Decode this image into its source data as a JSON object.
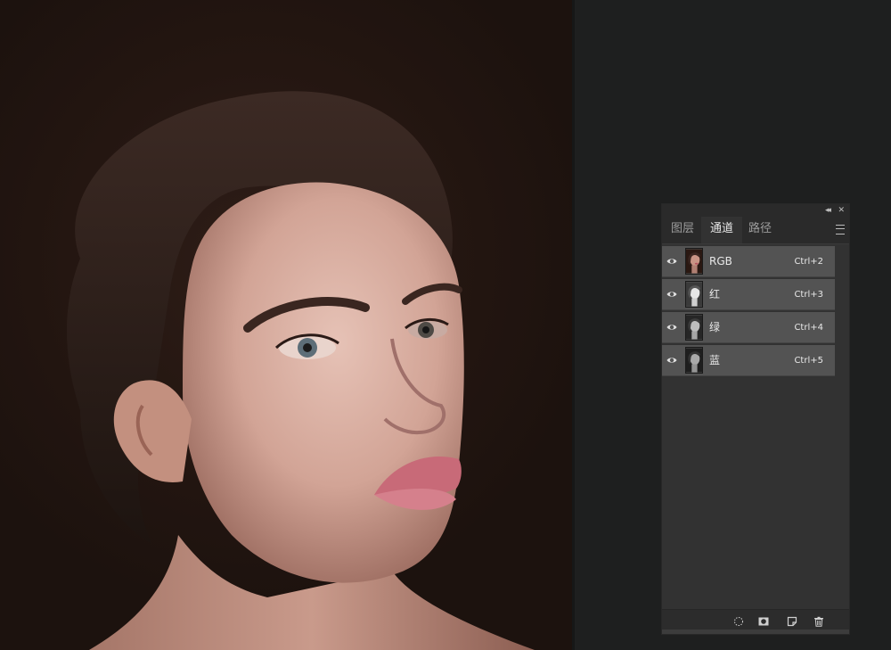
{
  "panel": {
    "tabs": [
      {
        "label": "图层",
        "active": false
      },
      {
        "label": "通道",
        "active": true
      },
      {
        "label": "路径",
        "active": false
      }
    ],
    "channels": [
      {
        "label": "RGB",
        "shortcut": "Ctrl+2",
        "thumbnail": "color"
      },
      {
        "label": "红",
        "shortcut": "Ctrl+3",
        "thumbnail": "grayscale-light"
      },
      {
        "label": "绿",
        "shortcut": "Ctrl+4",
        "thumbnail": "grayscale"
      },
      {
        "label": "蓝",
        "shortcut": "Ctrl+5",
        "thumbnail": "grayscale-dark"
      }
    ],
    "icons": {
      "collapse": "double-chevron-left-icon",
      "close": "close-icon",
      "menu": "panel-menu-icon",
      "bottom": [
        "load-selection-icon",
        "save-selection-icon",
        "new-channel-icon",
        "delete-channel-icon"
      ]
    }
  },
  "colors": {
    "workspace": "#1e1f1f",
    "panel": "#323232",
    "row_highlight": "#535353"
  }
}
